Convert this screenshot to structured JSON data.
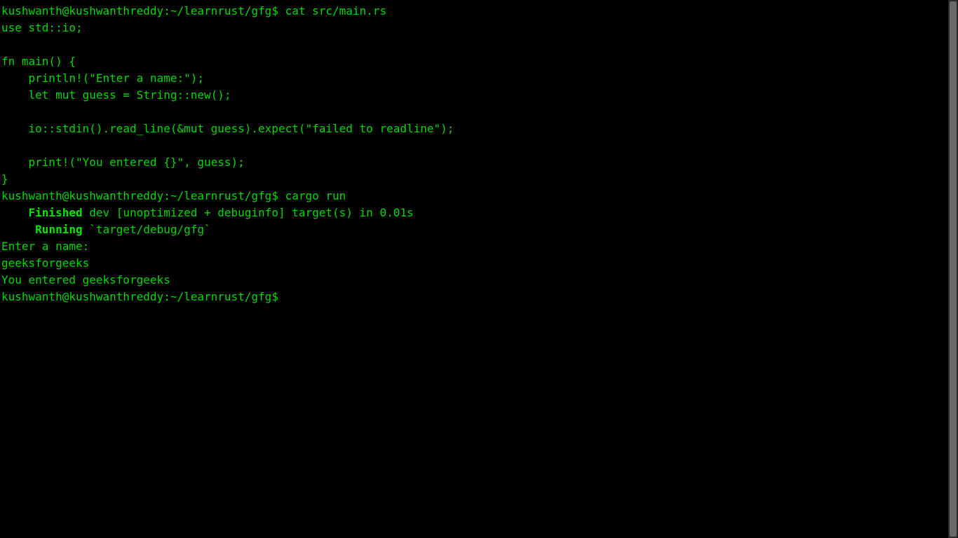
{
  "terminal": {
    "lines": [
      {
        "type": "prompt_cmd",
        "prompt": "kushwanth@kushwanthreddy:~/learnrust/gfg$",
        "cmd": " cat src/main.rs"
      },
      {
        "type": "code",
        "text": "use std::io;"
      },
      {
        "type": "blank"
      },
      {
        "type": "code",
        "text": "fn main() {"
      },
      {
        "type": "code",
        "text": "    println!(\"Enter a name:\");"
      },
      {
        "type": "code",
        "text": "    let mut guess = String::new();"
      },
      {
        "type": "blank"
      },
      {
        "type": "code",
        "text": "    io::stdin().read_line(&mut guess).expect(\"failed to readline\");"
      },
      {
        "type": "blank"
      },
      {
        "type": "code",
        "text": "    print!(\"You entered {}\", guess);"
      },
      {
        "type": "code",
        "text": "}"
      },
      {
        "type": "prompt_cmd",
        "prompt": "kushwanth@kushwanthreddy:~/learnrust/gfg$",
        "cmd": " cargo run"
      },
      {
        "type": "bold_line",
        "lead": "    ",
        "bold": "Finished",
        "rest": " dev [unoptimized + debuginfo] target(s) in 0.01s"
      },
      {
        "type": "bold_line",
        "lead": "     ",
        "bold": "Running",
        "rest": " `target/debug/gfg`"
      },
      {
        "type": "code",
        "text": "Enter a name:"
      },
      {
        "type": "code",
        "text": "geeksforgeeks"
      },
      {
        "type": "code",
        "text": "You entered geeksforgeeks"
      },
      {
        "type": "prompt_cmd",
        "prompt": "kushwanth@kushwanthreddy:~/learnrust/gfg$",
        "cmd": " "
      }
    ]
  }
}
